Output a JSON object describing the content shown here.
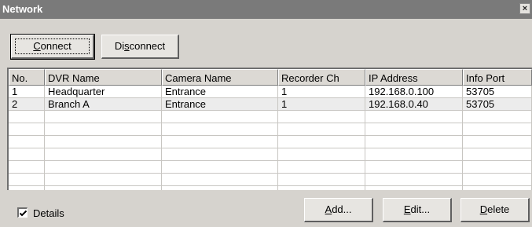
{
  "window": {
    "title": "Network",
    "close_glyph": "×"
  },
  "toolbar": {
    "connect": {
      "key": "C",
      "rest": "onnect"
    },
    "disconnect": {
      "pre": "Di",
      "key": "s",
      "rest": "connect"
    }
  },
  "table": {
    "columns": [
      "No.",
      "DVR Name",
      "Camera Name",
      "Recorder Ch",
      "IP Address",
      "Info Port"
    ],
    "rows": [
      [
        "1",
        "Headquarter",
        "Entrance",
        "1",
        "192.168.0.100",
        "53705"
      ],
      [
        "2",
        "Branch A",
        "Entrance",
        "1",
        "192.168.0.40",
        "53705"
      ]
    ]
  },
  "details": {
    "label": "Details",
    "checked": true
  },
  "buttons": {
    "add": {
      "key": "A",
      "rest": "dd..."
    },
    "edit": {
      "key": "E",
      "rest": "dit..."
    },
    "delete": {
      "key": "D",
      "rest": "elete"
    }
  },
  "colors": {
    "title_bg": "#7a7a7a",
    "window_bg": "#d6d3ce",
    "alt_row": "#ececec"
  },
  "icons": {
    "close": "close-icon",
    "check": "check-icon"
  }
}
